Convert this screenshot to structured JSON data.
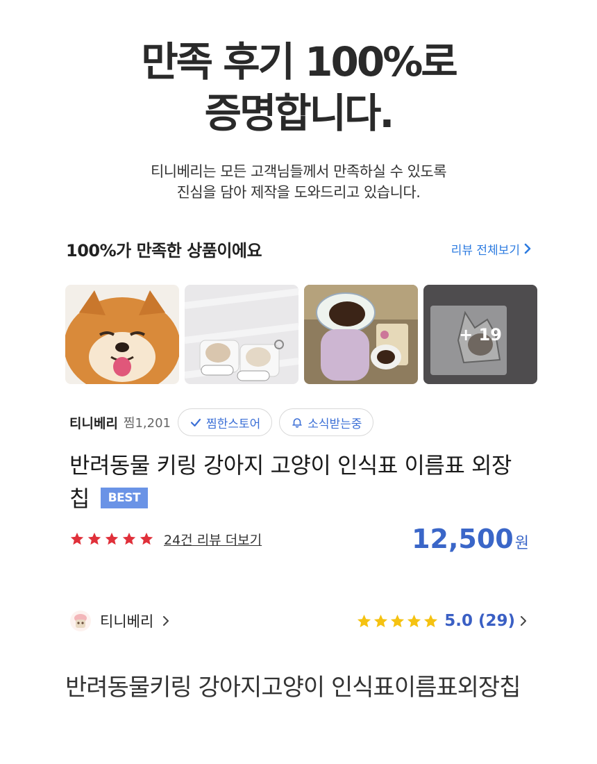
{
  "hero": {
    "title_line1": "만족 후기 100%로",
    "title_line2": "증명합니다.",
    "sub_line1": "티니베리는 모든 고객님들께서 만족하실 수 있도록",
    "sub_line2": "진심을 담아 제작을 도와드리고 있습니다."
  },
  "reviews": {
    "section_title": "100%가 만족한 상품이에요",
    "see_all_label": "리뷰 전체보기",
    "more_photos_label": "+ 19"
  },
  "store": {
    "name": "티니베리",
    "wish_count": "찜1,201",
    "wished_label": "찜한스토어",
    "notify_label": "소식받는중"
  },
  "product": {
    "title": "반려동물 키링 강아지 고양이 인식표 이름표 외장칩",
    "badge": "BEST",
    "review_link": "24건 리뷰 더보기",
    "price": "12,500",
    "price_unit": "원",
    "stars": 5
  },
  "seller": {
    "name": "티니베리",
    "rating": "5.0 (29)",
    "stars": 5
  },
  "bottom": {
    "product_name": "반려동물키링 강아지고양이 인식표이름표외장칩"
  },
  "colors": {
    "accent_blue": "#3a66c8",
    "link_blue": "#2d7be0",
    "star_red": "#e0303a",
    "star_gold": "#f5c211",
    "badge_blue": "#6a93e6"
  },
  "icons": {
    "see_all": "chevron-right-icon",
    "wished": "check-icon",
    "notify": "bell-icon",
    "seller": "chevron-right-icon"
  }
}
